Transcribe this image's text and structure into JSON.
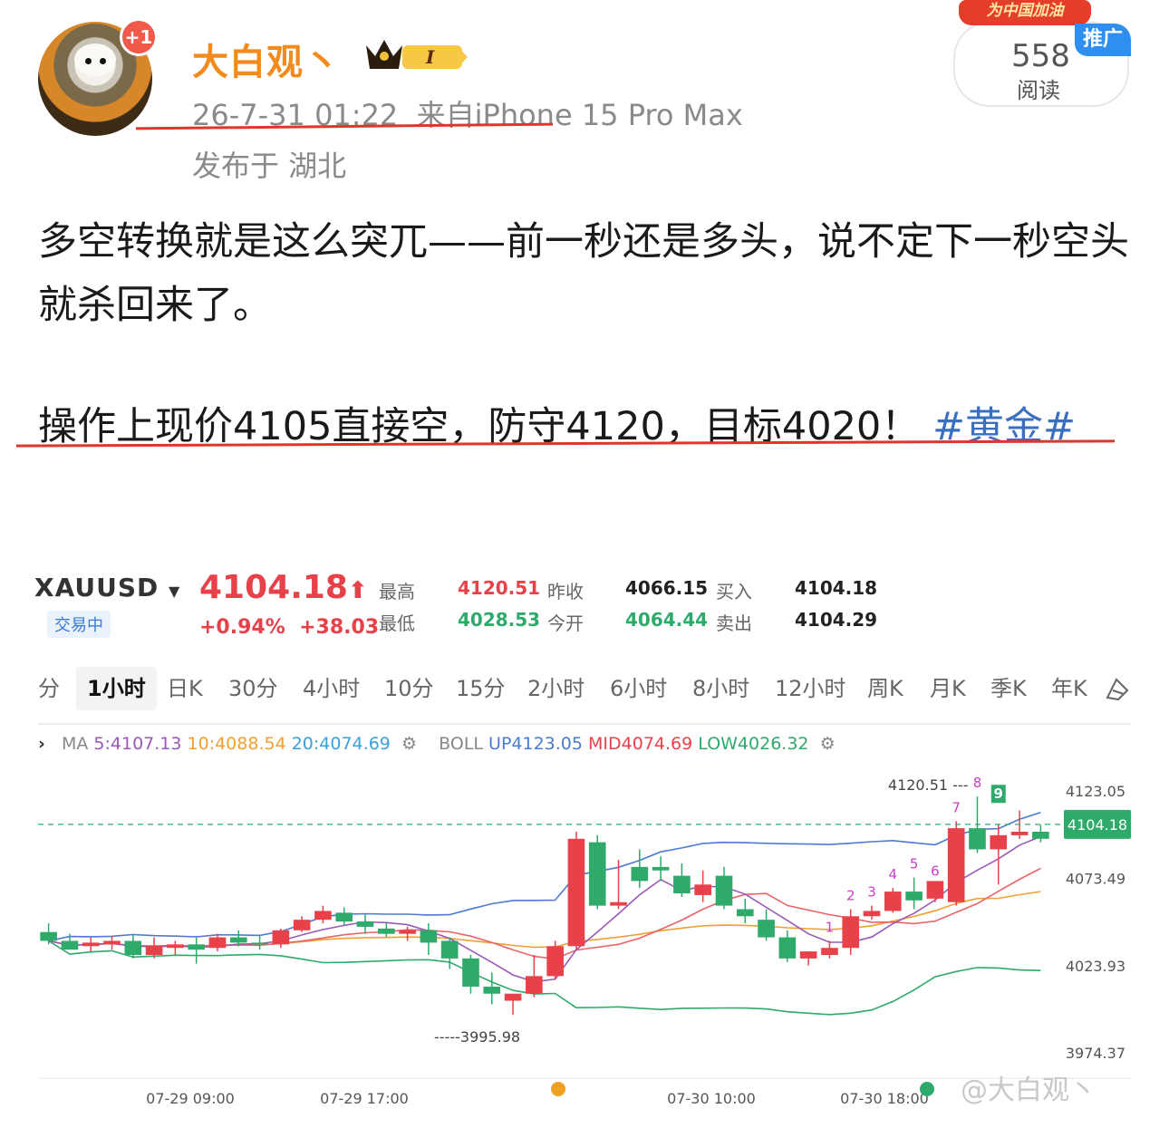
{
  "post": {
    "username": "大白观丶",
    "notification_badge": "+1",
    "vip_level": "I",
    "timestamp": "26-7-31 01:22",
    "source": "来自iPhone 15 Pro Max",
    "location": "发布于 湖北",
    "promo_tag": "为中国加油",
    "promote_label": "推广",
    "read_count": "558",
    "read_label": "阅读",
    "text_line1": "多空转换就是这么突兀——前一秒还是多头，说不定下一秒空头就杀回来了。",
    "text_line2": "操作上现价4105直接空，防守4120，目标4020！",
    "hashtag": "#黄金#"
  },
  "quote": {
    "symbol": "XAUUSD",
    "status": "交易中",
    "price": "4104.18",
    "change_pct": "+0.94%",
    "change_abs": "+38.03",
    "high_label": "最高",
    "high": "4120.51",
    "low_label": "最低",
    "low": "4028.53",
    "prev_close_label": "昨收",
    "prev_close": "4066.15",
    "open_label": "今开",
    "open": "4064.44",
    "bid_label": "买入",
    "bid": "4104.18",
    "ask_label": "卖出",
    "ask": "4104.29",
    "colors": {
      "up": "#e8414a",
      "down": "#2eaa6b"
    }
  },
  "tabs": [
    "分",
    "1小时",
    "日K",
    "30分",
    "4小时",
    "10分",
    "15分",
    "2小时",
    "6小时",
    "8小时",
    "12小时",
    "周K",
    "月K",
    "季K",
    "年K"
  ],
  "active_tab": "1小时",
  "indicators": {
    "ma_label": "MA",
    "ma5": "5:4107.13",
    "ma10": "10:4088.54",
    "ma20": "20:4074.69",
    "boll_label": "BOLL",
    "boll_up": "UP4123.05",
    "boll_mid": "MID4074.69",
    "boll_low": "LOW4026.32"
  },
  "watermark": "@大白观丶",
  "chart_data": {
    "type": "candlestick",
    "symbol": "XAUUSD",
    "interval": "1小时",
    "y_ticks": [
      4123.05,
      4073.49,
      4023.93,
      3974.37
    ],
    "ylim": [
      3974.37,
      4123.05
    ],
    "x_ticks": [
      "07-29 09:00",
      "07-29 17:00",
      "07-30 10:00",
      "07-30 18:00"
    ],
    "current_price": 4104.18,
    "max_label": "4120.51",
    "min_label": "3995.98",
    "candles": [
      [
        4043,
        4048,
        4038,
        4036
      ],
      [
        4038,
        4042,
        4033,
        4036
      ],
      [
        4035,
        4040,
        4037,
        4032
      ],
      [
        4036,
        4041,
        4038,
        4033
      ],
      [
        4038,
        4042,
        4030,
        4028
      ],
      [
        4030,
        4040,
        4035,
        4028
      ],
      [
        4034,
        4038,
        4036,
        4030
      ],
      [
        4036,
        4040,
        4033,
        4025
      ],
      [
        4034,
        4042,
        4040,
        4032
      ],
      [
        4040,
        4044,
        4037,
        4035
      ],
      [
        4037,
        4041,
        4036,
        4033
      ],
      [
        4036,
        4045,
        4044,
        4034
      ],
      [
        4044,
        4052,
        4050,
        4043
      ],
      [
        4050,
        4058,
        4055,
        4048
      ],
      [
        4054,
        4057,
        4049,
        4047
      ],
      [
        4049,
        4053,
        4046,
        4042
      ],
      [
        4045,
        4048,
        4042,
        4040
      ],
      [
        4042,
        4046,
        4044,
        4038
      ],
      [
        4044,
        4048,
        4037,
        4030
      ],
      [
        4038,
        4040,
        4028,
        4022
      ],
      [
        4028,
        4030,
        4012,
        4008
      ],
      [
        4012,
        4020,
        4008,
        4002
      ],
      [
        4004,
        4008,
        4008,
        3996
      ],
      [
        4008,
        4030,
        4018,
        4006
      ],
      [
        4018,
        4038,
        4035,
        4016
      ],
      [
        4035,
        4100,
        4096,
        4033
      ],
      [
        4094,
        4098,
        4058,
        4056
      ],
      [
        4058,
        4084,
        4060,
        4056
      ],
      [
        4080,
        4090,
        4072,
        4068
      ],
      [
        4080,
        4086,
        4078,
        4072
      ],
      [
        4075,
        4082,
        4065,
        4063
      ],
      [
        4064,
        4078,
        4070,
        4060
      ],
      [
        4075,
        4080,
        4058,
        4056
      ],
      [
        4056,
        4062,
        4052,
        4048
      ],
      [
        4050,
        4056,
        4040,
        4038
      ],
      [
        4040,
        4044,
        4028,
        4026
      ],
      [
        4028,
        4032,
        4032,
        4024
      ],
      [
        4030,
        4038,
        4034,
        4028
      ],
      [
        4034,
        4056,
        4052,
        4030
      ],
      [
        4052,
        4058,
        4055,
        4050
      ],
      [
        4055,
        4068,
        4066,
        4054
      ],
      [
        4066,
        4074,
        4061,
        4056
      ],
      [
        4062,
        4070,
        4072,
        4060
      ],
      [
        4060,
        4106,
        4102,
        4058
      ],
      [
        4102,
        4120,
        4090,
        4088
      ],
      [
        4090,
        4104,
        4098,
        4070
      ],
      [
        4098,
        4112,
        4100,
        4096
      ],
      [
        4100,
        4104,
        4096,
        4094
      ]
    ],
    "candle_format": "[open, high, close, low]",
    "td_sequence_labels": [
      "1",
      "2",
      "3",
      "4",
      "5",
      "6",
      "7",
      "8",
      "9"
    ]
  }
}
